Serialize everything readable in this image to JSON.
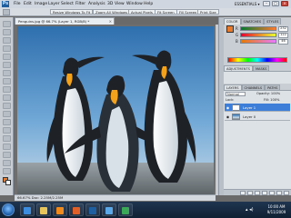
{
  "app": {
    "logo": "Ps",
    "workspace": "ESSENTIALS ▾"
  },
  "menu": [
    "File",
    "Edit",
    "Image",
    "Layer",
    "Select",
    "Filter",
    "Analysis",
    "3D",
    "View",
    "Window",
    "Help"
  ],
  "options_bar": {
    "buttons": [
      "Resize Windows To Fit",
      "Zoom All Windows",
      "Actual Pixels",
      "Fit Screen",
      "Fill Screen",
      "Print Size"
    ]
  },
  "document": {
    "tab_title": "Penguins.jpg @ 66.7% (Layer 1, RGB/8) *",
    "status": "66.67%   Doc: 2.25M/2.25M"
  },
  "panels": {
    "color_tabs": [
      "COLOR",
      "SWATCHES",
      "STYLES"
    ],
    "channels": [
      {
        "label": "R",
        "value": "232"
      },
      {
        "label": "G",
        "value": "122"
      },
      {
        "label": "B",
        "value": "46"
      }
    ],
    "adjust_tabs": [
      "ADJUSTMENTS",
      "MASKS"
    ],
    "layers_tabs": [
      "LAYERS",
      "CHANNELS",
      "PATHS"
    ],
    "blend_mode": "Normal",
    "opacity_label": "Opacity: 100%",
    "lock_label": "Lock:",
    "fill_label": "Fill: 100%",
    "layers": [
      {
        "name": "Layer 1",
        "selected": true
      },
      {
        "name": "Layer 0",
        "selected": false
      }
    ]
  },
  "colors": {
    "foreground": "#e87a2e",
    "background": "#ffffff",
    "accent": "#3d7fd8"
  },
  "taskbar": {
    "time": "10:00 AM",
    "date": "9/11/2009",
    "icons": [
      "start-orb",
      "ie-icon",
      "folder-icon",
      "media-icon",
      "firefox-icon",
      "photoshop-icon",
      "mail-icon",
      "chrome-icon"
    ]
  }
}
